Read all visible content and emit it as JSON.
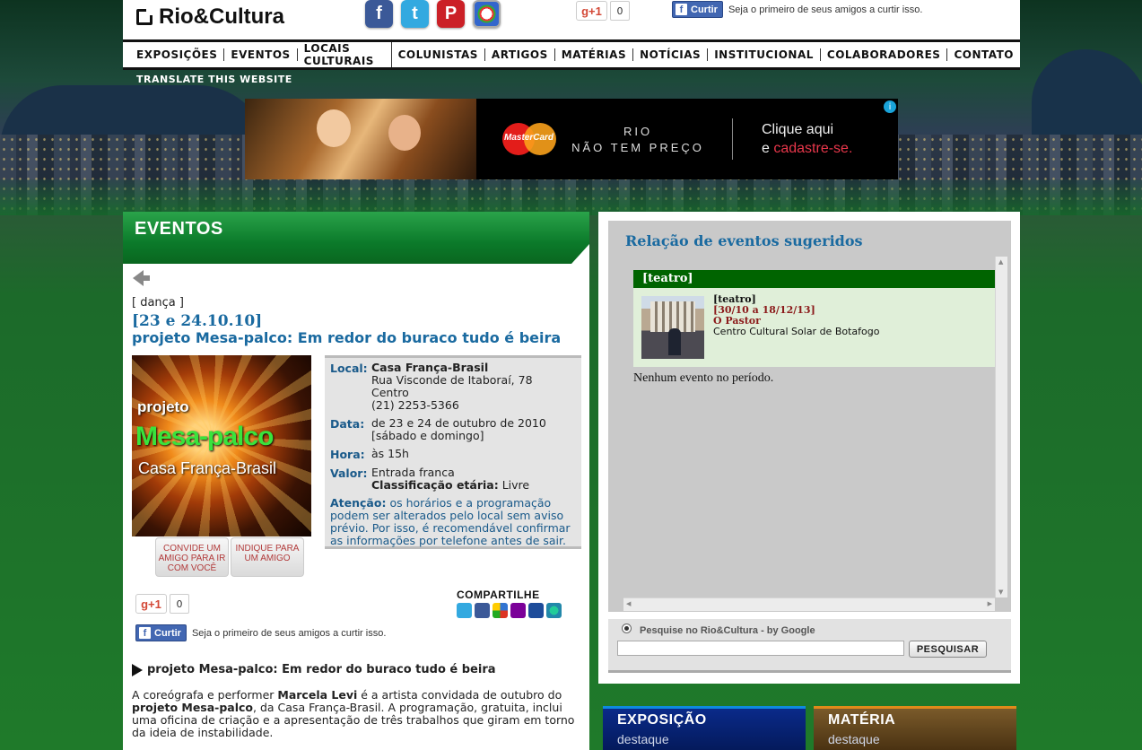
{
  "header": {
    "logo_text": "Rio&Cultura",
    "social_icons": [
      "facebook-icon",
      "twitter-icon",
      "pinterest-icon",
      "picasa-icon"
    ],
    "gplus_label": "g+1",
    "gplus_count": "0",
    "fb_like_label": "Curtir",
    "fb_like_text": "Seja o primeiro de seus amigos a curtir isso."
  },
  "nav": {
    "items": [
      "EXPOSIÇÕES",
      "EVENTOS",
      "LOCAIS CULTURAIS",
      "COLUNISTAS",
      "ARTIGOS",
      "MATÉRIAS",
      "NOTÍCIAS",
      "INSTITUCIONAL",
      "COLABORADORES",
      "CONTATO"
    ],
    "translate": "TRANSLATE THIS WEBSITE"
  },
  "ad": {
    "brand": "MasterCard",
    "slogan_line1": "RIO",
    "slogan_line2": "NÃO TEM PREÇO",
    "cta_line1": "Clique aqui",
    "cta_prefix": "e",
    "cta_highlight": "cadastre-se.",
    "info": "i"
  },
  "main": {
    "section_title": "EVENTOS",
    "category": "[ dança ]",
    "date": "[23 e 24.10.10]",
    "title": "projeto Mesa-palco: Em redor do buraco tudo é beira",
    "poster": {
      "line1": "projeto",
      "line2": "Mesa-palco",
      "line3": "Casa França-Brasil"
    },
    "invite_button": "CONVIDE UM AMIGO PARA IR COM VOCÊ",
    "recommend_button": "INDIQUE PARA UM AMIGO",
    "info": {
      "local_label": "Local:",
      "local_name": "Casa França-Brasil",
      "local_address": "Rua Visconde de Itaboraí, 78",
      "local_district": "Centro",
      "local_phone": "(21) 2253-5366",
      "date_label": "Data:",
      "date_value": "de 23 e 24 de outubro de 2010",
      "date_days": "[sábado e domingo]",
      "time_label": "Hora:",
      "time_value": "às 15h",
      "price_label": "Valor:",
      "price_value": "Entrada franca",
      "rating_label": "Classificação etária:",
      "rating_value": "Livre",
      "notice_label": "Atenção:",
      "notice_text": "os horários e a programação podem ser alterados pelo local sem aviso prévio. Por isso, é recomendável confirmar as informações por telefone antes de sair."
    },
    "share_title": "COMPARTILHE",
    "share_icons": [
      "twitter-icon",
      "facebook-icon",
      "delicious-icon",
      "yahoo-icon",
      "myspace-icon",
      "orkut-icon"
    ],
    "article_title": "projeto Mesa-palco: Em redor do buraco tudo é beira",
    "article": {
      "p1": "A coreógrafa e performer ",
      "p2": "Marcela Levi",
      "p3": " é a artista convidada de outubro do ",
      "p4": "projeto Mesa-palco",
      "p5": ", da Casa França-Brasil. A programação, gratuita, inclui uma oficina de criação e a apresentação de três trabalhos que giram em torno da ideia de instabilidade."
    }
  },
  "sidebar": {
    "title": "Relação de eventos sugeridos",
    "category": "[teatro]",
    "event": {
      "category": "[teatro]",
      "dates": "[30/10 a 18/12/13]",
      "name": "O Pastor",
      "place": "Centro Cultural Solar de Botafogo"
    },
    "empty": "Nenhum evento no período.",
    "search_label": "Pesquise no Rio&Cultura - by Google",
    "search_value": "",
    "search_button": "PESQUISAR"
  },
  "tabs": {
    "exposicao_title": "EXPOSIÇÃO",
    "exposicao_sub": "destaque",
    "materia_title": "MATÉRIA",
    "materia_sub": "destaque"
  },
  "colors": {
    "green_header": "#0b7a2a",
    "link_blue": "#1a6aa0",
    "category_green": "#006400",
    "event_red": "#8b1a1a"
  }
}
